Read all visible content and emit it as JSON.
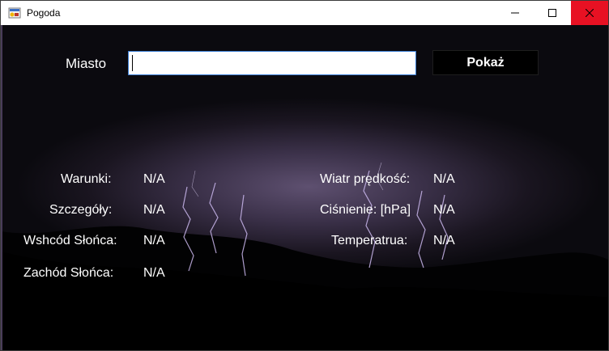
{
  "window": {
    "title": "Pogoda"
  },
  "search": {
    "label": "Miasto",
    "value": "",
    "button": "Pokaż"
  },
  "fields": [
    {
      "label": "Warunki:",
      "value": "N/A"
    },
    {
      "label": "Szczegóły:",
      "value": "N/A"
    },
    {
      "label": "Wshcód Słońca:",
      "value": "N/A"
    },
    {
      "label": "Zachód Słońca:",
      "value": "N/A"
    },
    {
      "label": "Wiatr prędkość:",
      "value": "N/A"
    },
    {
      "label": "Ciśnienie:  [hPa]",
      "value": "N/A"
    },
    {
      "label": "Temperatrua:",
      "value": "N/A"
    }
  ],
  "icons": {
    "app": "sun-cloud-icon",
    "minimize": "minimize-icon",
    "maximize": "maximize-icon",
    "close": "close-icon"
  },
  "colors": {
    "close_hover": "#e81123",
    "input_border": "#3c7fd6",
    "window_bg": "#000000"
  }
}
